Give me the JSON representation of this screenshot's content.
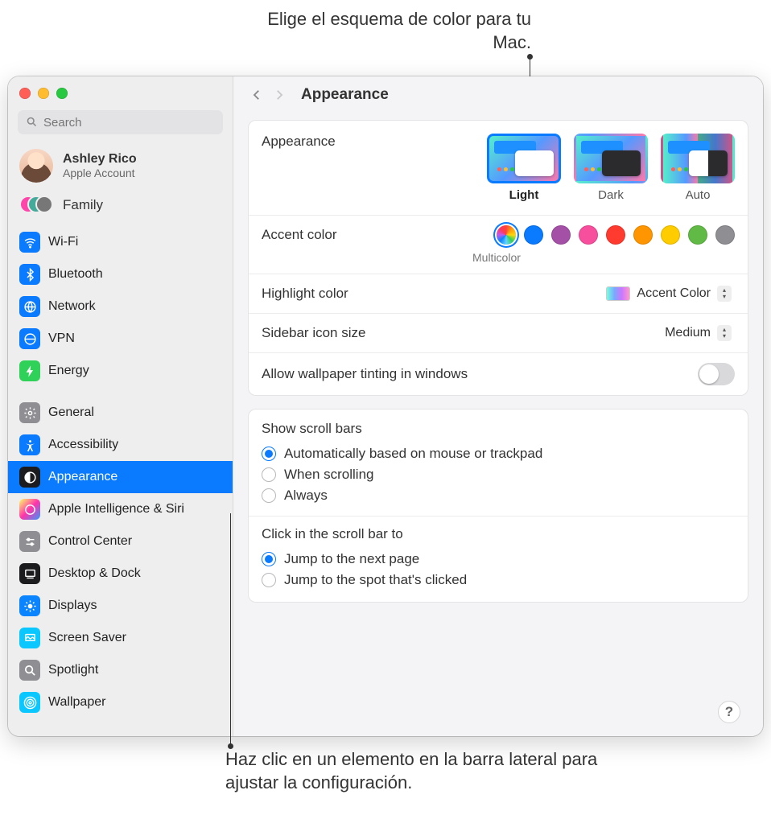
{
  "callouts": {
    "top": "Elige el esquema de color para tu Mac.",
    "bottom": "Haz clic en un elemento en la barra lateral para ajustar la configuración."
  },
  "search": {
    "placeholder": "Search"
  },
  "account": {
    "name": "Ashley Rico",
    "sub": "Apple Account"
  },
  "family": {
    "label": "Family"
  },
  "sidebar": {
    "items": [
      {
        "id": "wifi",
        "label": "Wi-Fi",
        "color": "#0a7aff"
      },
      {
        "id": "bluetooth",
        "label": "Bluetooth",
        "color": "#0a7aff"
      },
      {
        "id": "network",
        "label": "Network",
        "color": "#0a7aff"
      },
      {
        "id": "vpn",
        "label": "VPN",
        "color": "#0a7aff"
      },
      {
        "id": "energy",
        "label": "Energy",
        "color": "#30d158"
      },
      {
        "id": null
      },
      {
        "id": "general",
        "label": "General",
        "color": "#8e8e93"
      },
      {
        "id": "accessibility",
        "label": "Accessibility",
        "color": "#0a7aff"
      },
      {
        "id": "appearance",
        "label": "Appearance",
        "color": "#1c1c1e",
        "selected": true
      },
      {
        "id": "siri",
        "label": "Apple Intelligence & Siri",
        "color": "grad"
      },
      {
        "id": "controlcenter",
        "label": "Control Center",
        "color": "#8e8e93"
      },
      {
        "id": "desktop",
        "label": "Desktop & Dock",
        "color": "#1c1c1e"
      },
      {
        "id": "displays",
        "label": "Displays",
        "color": "#0a84ff"
      },
      {
        "id": "screensaver",
        "label": "Screen Saver",
        "color": "#0ac8ff"
      },
      {
        "id": "spotlight",
        "label": "Spotlight",
        "color": "#8e8e93"
      },
      {
        "id": "wallpaper",
        "label": "Wallpaper",
        "color": "#0ac8ff"
      }
    ]
  },
  "header": {
    "title": "Appearance"
  },
  "settings": {
    "appearance": {
      "label": "Appearance",
      "options": [
        {
          "id": "light",
          "label": "Light",
          "selected": true
        },
        {
          "id": "dark",
          "label": "Dark"
        },
        {
          "id": "auto",
          "label": "Auto"
        }
      ]
    },
    "accent": {
      "label": "Accent color",
      "selected_name": "Multicolor",
      "colors": [
        "multicolor",
        "#0a7aff",
        "#a550a7",
        "#f74f9e",
        "#ff3b30",
        "#ff9500",
        "#ffcc00",
        "#62ba46",
        "#8e8e93"
      ]
    },
    "highlight": {
      "label": "Highlight color",
      "value": "Accent Color"
    },
    "sidebar_icon": {
      "label": "Sidebar icon size",
      "value": "Medium"
    },
    "tinting": {
      "label": "Allow wallpaper tinting in windows",
      "on": false
    },
    "scrollbars": {
      "title": "Show scroll bars",
      "options": [
        {
          "label": "Automatically based on mouse or trackpad",
          "checked": true
        },
        {
          "label": "When scrolling",
          "checked": false
        },
        {
          "label": "Always",
          "checked": false
        }
      ]
    },
    "scrollclick": {
      "title": "Click in the scroll bar to",
      "options": [
        {
          "label": "Jump to the next page",
          "checked": true
        },
        {
          "label": "Jump to the spot that's clicked",
          "checked": false
        }
      ]
    }
  },
  "help": "?"
}
